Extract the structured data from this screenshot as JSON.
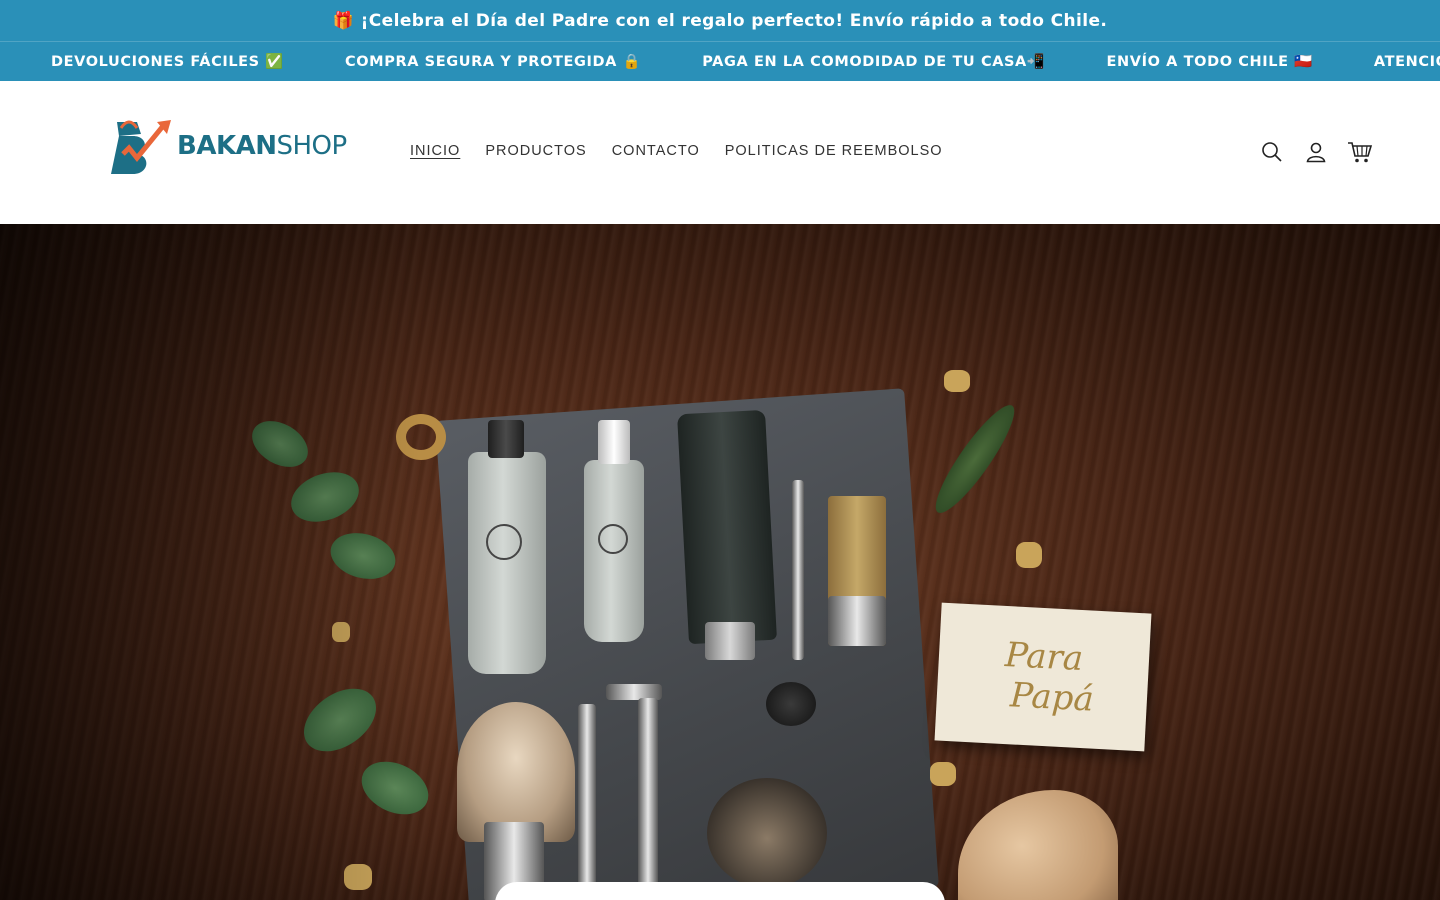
{
  "announcement": {
    "text": "🎁 ¡Celebra el Día del Padre con el regalo perfecto! Envío rápido a todo Chile."
  },
  "marquee": {
    "items": [
      "DEVOLUCIONES FÁCILES ✅",
      "COMPRA SEGURA Y PROTEGIDA 🔒",
      "PAGA EN LA COMODIDAD DE TU CASA📲",
      "ENVÍO A TODO CHILE 🇨🇱",
      "ATENCIÓN PERS"
    ]
  },
  "header": {
    "logo": {
      "bold": "BAKAN",
      "light": "SHOP"
    },
    "nav": [
      {
        "label": "INICIO",
        "active": true
      },
      {
        "label": "PRODUCTOS",
        "active": false
      },
      {
        "label": "CONTACTO",
        "active": false
      },
      {
        "label": "POLITICAS DE REEMBOLSO",
        "active": false
      }
    ],
    "icons": [
      "search-icon",
      "account-icon",
      "cart-icon"
    ]
  },
  "hero": {
    "card_line1": "Para",
    "card_line2": "Papá"
  },
  "colors": {
    "brand_blue": "#2a90b8",
    "logo_teal": "#1d6f86",
    "logo_orange": "#e9673a"
  }
}
